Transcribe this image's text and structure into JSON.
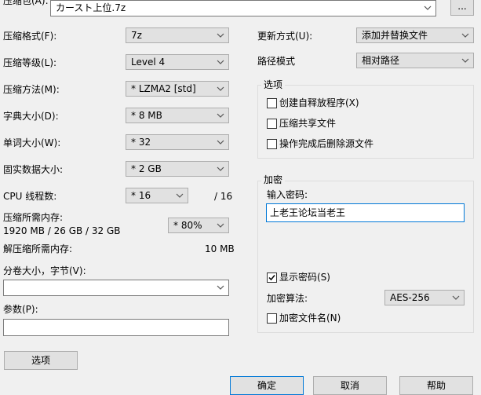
{
  "archive": {
    "label": "压缩包(A):",
    "value": "カースト上位.7z",
    "browse_label": "..."
  },
  "left": {
    "format": {
      "label": "压缩格式(F):",
      "value": "7z"
    },
    "level": {
      "label": "压缩等级(L):",
      "value": "Level 4"
    },
    "method": {
      "label": "压缩方法(M):",
      "value": "*  LZMA2 [std]"
    },
    "dict": {
      "label": "字典大小(D):",
      "value": "*  8 MB"
    },
    "word": {
      "label": "单词大小(W):",
      "value": "*  32"
    },
    "solid": {
      "label": "固实数据大小:",
      "value": "*  2 GB"
    },
    "threads": {
      "label": "CPU 线程数:",
      "value": "*  16",
      "max": "/ 16"
    },
    "memory": {
      "label": "压缩所需内存:",
      "detail": "1920 MB / 26 GB / 32 GB",
      "value": "* 80%"
    },
    "decomp_memory": {
      "label": "解压缩所需内存:",
      "value": "10 MB"
    },
    "split": {
      "label": "分卷大小，字节(V):",
      "value": ""
    },
    "params": {
      "label": "参数(P):",
      "value": ""
    },
    "options_button": "选项"
  },
  "right": {
    "update_mode": {
      "label": "更新方式(U):",
      "value": "添加并替换文件"
    },
    "path_mode": {
      "label": "路径模式",
      "value": "相对路径"
    },
    "options_group": {
      "title": "选项",
      "sfx": {
        "label": "创建自释放程序(X)",
        "checked": false
      },
      "shared": {
        "label": "压缩共享文件",
        "checked": false
      },
      "delete_after": {
        "label": "操作完成后删除源文件",
        "checked": false
      }
    },
    "encryption": {
      "title": "加密",
      "password_label": "输入密码:",
      "password_value": "上老王论坛当老王",
      "show_password": {
        "label": "显示密码(S)",
        "checked": true
      },
      "method_label": "加密算法:",
      "method_value": "AES-256",
      "encrypt_names": {
        "label": "加密文件名(N)",
        "checked": false
      }
    }
  },
  "buttons": {
    "ok": "确定",
    "cancel": "取消",
    "help": "帮助"
  }
}
